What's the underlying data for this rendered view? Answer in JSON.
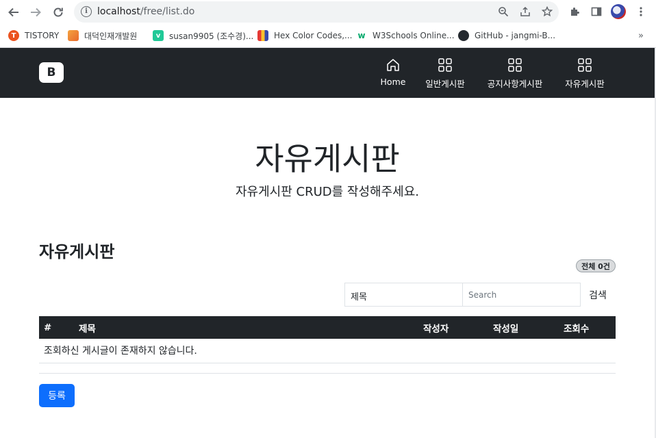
{
  "browser": {
    "url_host": "localhost",
    "url_path": "/free/list.do",
    "bookmarks": [
      {
        "label": "TISTORY",
        "icon": "tistory-icon",
        "color": "#eb531f"
      },
      {
        "label": "대덕인재개발원",
        "icon": "ddit-icon",
        "color": "#f4a340"
      },
      {
        "label": "susan9905 (조수경)...",
        "icon": "velog-icon",
        "color": "#20c997"
      },
      {
        "label": "Hex Color Codes,...",
        "icon": "hex-book-icon",
        "color": "#3f51b5"
      },
      {
        "label": "W3Schools Online...",
        "icon": "w3schools-icon",
        "color": "#04aa6d"
      },
      {
        "label": "GitHub - jangmi-B...",
        "icon": "github-icon",
        "color": "#24292f"
      }
    ],
    "more": "»"
  },
  "navbar": {
    "brand": "B",
    "items": [
      {
        "label": "Home",
        "icon": "house-icon"
      },
      {
        "label": "일반게시판",
        "icon": "grid-icon"
      },
      {
        "label": "공지사항게시판",
        "icon": "grid-icon"
      },
      {
        "label": "자유게시판",
        "icon": "grid-icon"
      }
    ]
  },
  "hero": {
    "title": "자유게시판",
    "subtitle": "자유게시판 CRUD를 작성해주세요."
  },
  "board": {
    "title": "자유게시판",
    "count_badge": "전체 0건",
    "search": {
      "select_value": "제목",
      "placeholder": "Search",
      "button": "검색"
    },
    "columns": [
      "#",
      "제목",
      "작성자",
      "작성일",
      "조회수"
    ],
    "empty_message": "조회하신 게시글이 존재하지 않습니다.",
    "register_button": "등록"
  },
  "colors": {
    "navbar_bg": "#212529",
    "primary": "#0d6efd"
  }
}
